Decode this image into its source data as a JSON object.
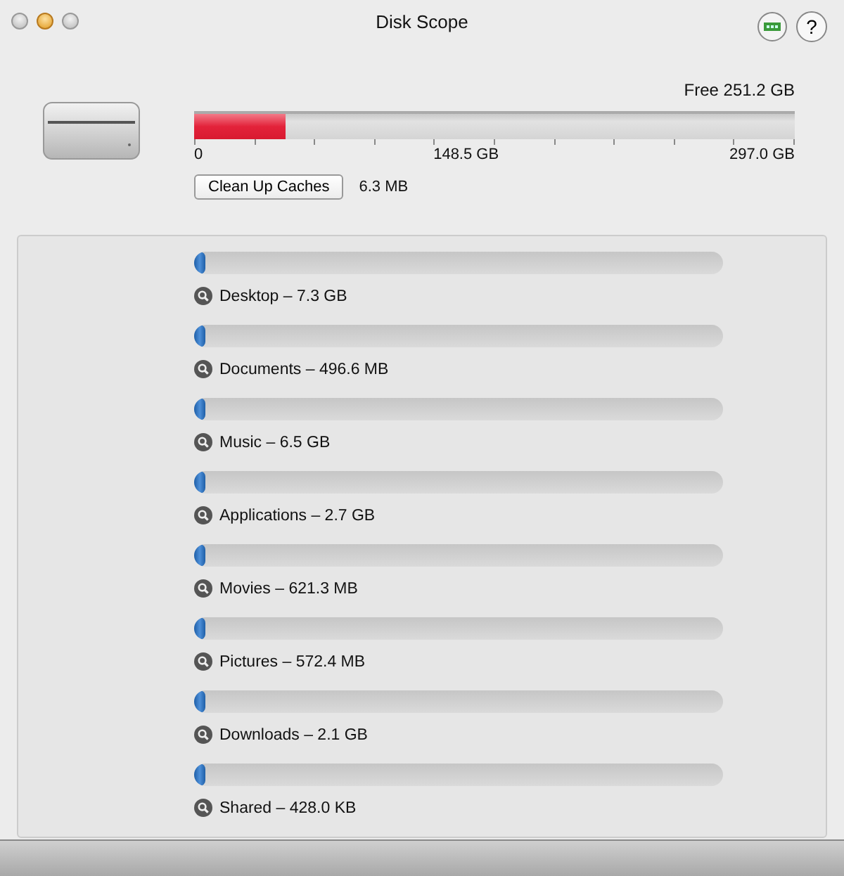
{
  "window": {
    "title": "Disk Scope",
    "help": "?"
  },
  "disk": {
    "free": "Free 251.2 GB",
    "level": 0.152,
    "ticks": [
      "0",
      "148.5 GB",
      "297.0 GB"
    ]
  },
  "cleanup": {
    "button": "Clean Up Caches",
    "size": "6.3 MB"
  },
  "folders": [
    {
      "label": "Desktop – 7.3 GB",
      "level": 0.02
    },
    {
      "label": "Documents – 496.6 MB",
      "level": 0.02
    },
    {
      "label": "Music – 6.5 GB",
      "level": 0.02
    },
    {
      "label": "Applications – 2.7 GB",
      "level": 0.02
    },
    {
      "label": "Movies – 621.3 MB",
      "level": 0.02
    },
    {
      "label": "Pictures – 572.4 MB",
      "level": 0.02
    },
    {
      "label": "Downloads – 2.1 GB",
      "level": 0.02
    },
    {
      "label": "Shared – 428.0 KB",
      "level": 0.02
    }
  ]
}
